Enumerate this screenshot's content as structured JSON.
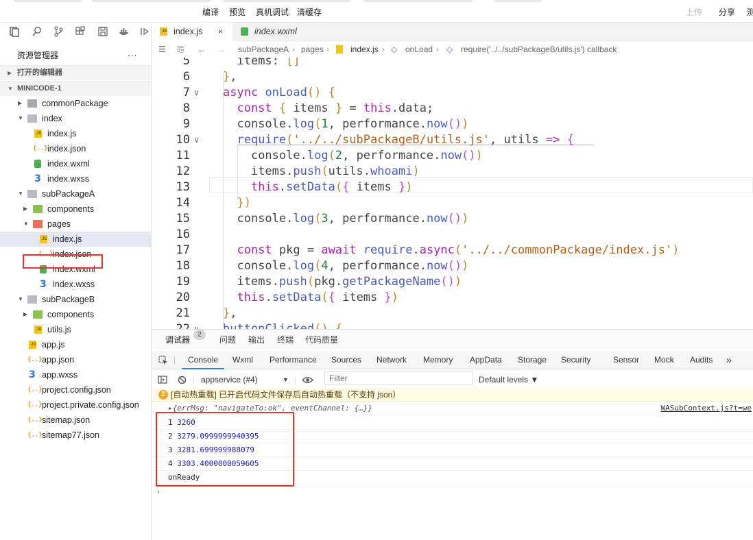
{
  "toolbar": {
    "compile_label": "编译",
    "preview_label": "预览",
    "realdevice_label": "真机调试",
    "clearcache_label": "清缓存",
    "upload_label": "上传",
    "share_label": "分享",
    "test_label": "测"
  },
  "sidebar": {
    "explorer_title": "资源管理器",
    "more_label": "...",
    "open_editors_label": "打开的编辑器",
    "project_label": "MINICODE-1",
    "tree": [
      {
        "label": "commonPackage",
        "kind": "folder",
        "depth": 1,
        "open": false
      },
      {
        "label": "index",
        "kind": "folder",
        "depth": 1,
        "open": true
      },
      {
        "label": "index.js",
        "kind": "js",
        "depth": 2
      },
      {
        "label": "index.json",
        "kind": "json",
        "depth": 2
      },
      {
        "label": "index.wxml",
        "kind": "wxml",
        "depth": 2
      },
      {
        "label": "index.wxss",
        "kind": "wxss",
        "depth": 2
      },
      {
        "label": "subPackageA",
        "kind": "folder",
        "depth": 1,
        "open": true
      },
      {
        "label": "components",
        "kind": "folder-green",
        "depth": 2,
        "open": false
      },
      {
        "label": "pages",
        "kind": "folder-red",
        "depth": 2,
        "open": true
      },
      {
        "label": "index.js",
        "kind": "js",
        "depth": 3,
        "selected": true
      },
      {
        "label": "index.json",
        "kind": "json",
        "depth": 3
      },
      {
        "label": "index.wxml",
        "kind": "wxml",
        "depth": 3
      },
      {
        "label": "index.wxss",
        "kind": "wxss",
        "depth": 3
      },
      {
        "label": "subPackageB",
        "kind": "folder",
        "depth": 1,
        "open": true
      },
      {
        "label": "components",
        "kind": "folder-green",
        "depth": 2,
        "open": false
      },
      {
        "label": "utils.js",
        "kind": "js",
        "depth": 2
      },
      {
        "label": "app.js",
        "kind": "js",
        "depth": 1
      },
      {
        "label": "app.json",
        "kind": "json",
        "depth": 1
      },
      {
        "label": "app.wxss",
        "kind": "wxss",
        "depth": 1
      },
      {
        "label": "project.config.json",
        "kind": "json",
        "depth": 1
      },
      {
        "label": "project.private.config.json",
        "kind": "json",
        "depth": 1
      },
      {
        "label": "sitemap.json",
        "kind": "json",
        "depth": 1
      },
      {
        "label": "sitemap77.json",
        "kind": "json",
        "depth": 1
      }
    ]
  },
  "editor": {
    "tabs": [
      {
        "label": "index.js",
        "active": true
      },
      {
        "label": "index.wxml",
        "active": false
      }
    ],
    "close_glyph": "×",
    "breadcrumb": [
      "subPackageA",
      "pages",
      "index.js",
      "onLoad",
      "require('../../subPackageB/utils.js') callback"
    ],
    "code_lines": [
      {
        "n": "5",
        "text": "  items: []"
      },
      {
        "n": "6",
        "text": "},"
      },
      {
        "n": "7",
        "text": "async onLoad() {"
      },
      {
        "n": "8",
        "text": "  const { items } = this.data;"
      },
      {
        "n": "9",
        "text": "  console.log(1, performance.now())"
      },
      {
        "n": "10",
        "text": "  require('../../subPackageB/utils.js', utils => {"
      },
      {
        "n": "11",
        "text": "    console.log(2, performance.now())"
      },
      {
        "n": "12",
        "text": "    items.push(utils.whoami)"
      },
      {
        "n": "13",
        "text": "    this.setData({ items })"
      },
      {
        "n": "14",
        "text": "  })"
      },
      {
        "n": "15",
        "text": "  console.log(3, performance.now())"
      },
      {
        "n": "16",
        "text": ""
      },
      {
        "n": "17",
        "text": "  const pkg = await require.async('../../commonPackage/index.js')"
      },
      {
        "n": "18",
        "text": "  console.log(4, performance.now())"
      },
      {
        "n": "19",
        "text": "  items.push(pkg.getPackageName())"
      },
      {
        "n": "20",
        "text": "  this.setData({ items })"
      },
      {
        "n": "21",
        "text": "},"
      },
      {
        "n": "22",
        "text": "buttonClicked() {"
      }
    ]
  },
  "devtools": {
    "top_tabs": [
      "调试器",
      "问题",
      "输出",
      "终端",
      "代码质量"
    ],
    "debugger_badge": "2",
    "panel_tabs": [
      "Console",
      "Wxml",
      "Performance",
      "Sources",
      "Network",
      "Memory",
      "AppData",
      "Storage",
      "Security",
      "Sensor",
      "Mock",
      "Audits"
    ],
    "more_tabs": "»",
    "context_select": "appservice (#4)",
    "filter_placeholder": "Filter",
    "levels_label": "Default levels ▼",
    "warning_count": "2",
    "warning_text": "[自动热重载] 已开启代码文件保存后自动热重载（不支持 json）",
    "object_log": "▸{errMsg: \"navigateTo:ok\", eventChannel: {…}}",
    "object_link": "WASubContext.js?t=we",
    "logs": [
      {
        "num": "1",
        "value": "3260"
      },
      {
        "num": "2",
        "value": "3279.0999999940395"
      },
      {
        "num": "3",
        "value": "3281.699999988079"
      },
      {
        "num": "4",
        "value": "3303.4000000059605"
      },
      {
        "num": "",
        "value": "onReady"
      }
    ],
    "prompt": "›"
  },
  "colors": {
    "accent": "#2b7bf0",
    "highlight_border": "#e3362b",
    "warning_bg": "#fffbe6"
  }
}
